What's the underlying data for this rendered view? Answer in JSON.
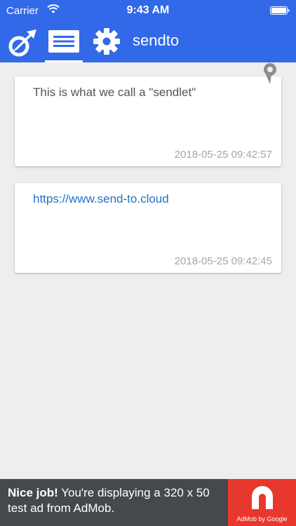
{
  "status_bar": {
    "carrier": "Carrier",
    "time": "9:43 AM",
    "wifi_icon": "wifi-icon",
    "battery_icon": "battery-full-icon"
  },
  "app_bar": {
    "title": "sendto",
    "logo_icon": "sendto-logo-icon",
    "tabs": [
      {
        "icon": "list-icon",
        "selected": true
      },
      {
        "icon": "gear-icon",
        "selected": false
      }
    ],
    "color": "#3169e8"
  },
  "sendlets": [
    {
      "text": "This is what we call a \"sendlet\"",
      "timestamp": "2018-05-25 09:42:57",
      "is_link": false,
      "pinned": true
    },
    {
      "text": "https://www.send-to.cloud",
      "timestamp": "2018-05-25 09:42:45",
      "is_link": true,
      "pinned": false
    }
  ],
  "ad_banner": {
    "bold": "Nice job!",
    "text": " You're displaying a 320 x 50 test ad from AdMob.",
    "byline": "AdMob by Google",
    "logo_color": "#e8382e"
  }
}
